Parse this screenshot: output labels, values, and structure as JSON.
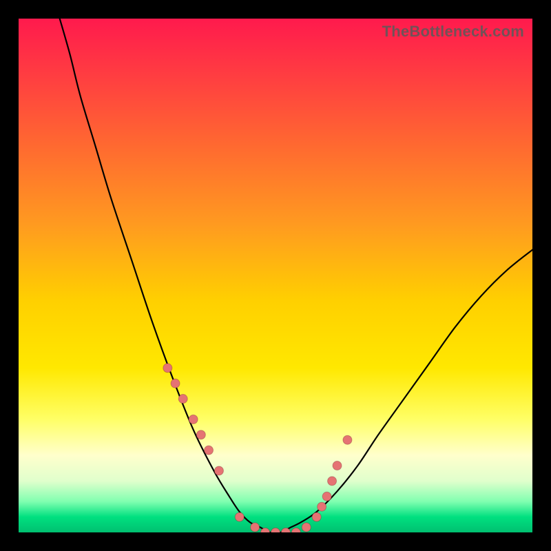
{
  "watermark": "TheBottleneck.com",
  "chart_data": {
    "type": "line",
    "title": "",
    "xlabel": "",
    "ylabel": "",
    "xlim": [
      0,
      100
    ],
    "ylim": [
      0,
      100
    ],
    "series": [
      {
        "name": "curve",
        "x": [
          8,
          10,
          12,
          15,
          18,
          22,
          26,
          30,
          34,
          38,
          41,
          43,
          45,
          47,
          49,
          51,
          53,
          55,
          58,
          62,
          66,
          70,
          75,
          80,
          85,
          90,
          95,
          100
        ],
        "y": [
          100,
          93,
          85,
          75,
          65,
          53,
          41,
          30,
          20,
          12,
          7,
          4,
          2,
          1,
          0,
          0,
          1,
          2,
          4,
          8,
          13,
          19,
          26,
          33,
          40,
          46,
          51,
          55
        ]
      }
    ],
    "markers": {
      "name": "dots",
      "x": [
        29,
        30.5,
        32,
        34,
        35.5,
        37,
        39,
        43,
        46,
        48,
        50,
        52,
        54,
        56,
        58,
        59,
        60,
        61,
        62,
        64
      ],
      "y": [
        32,
        29,
        26,
        22,
        19,
        16,
        12,
        3,
        1,
        0,
        0,
        0,
        0,
        1,
        3,
        5,
        7,
        10,
        13,
        18
      ]
    },
    "grid": false,
    "legend": false
  }
}
